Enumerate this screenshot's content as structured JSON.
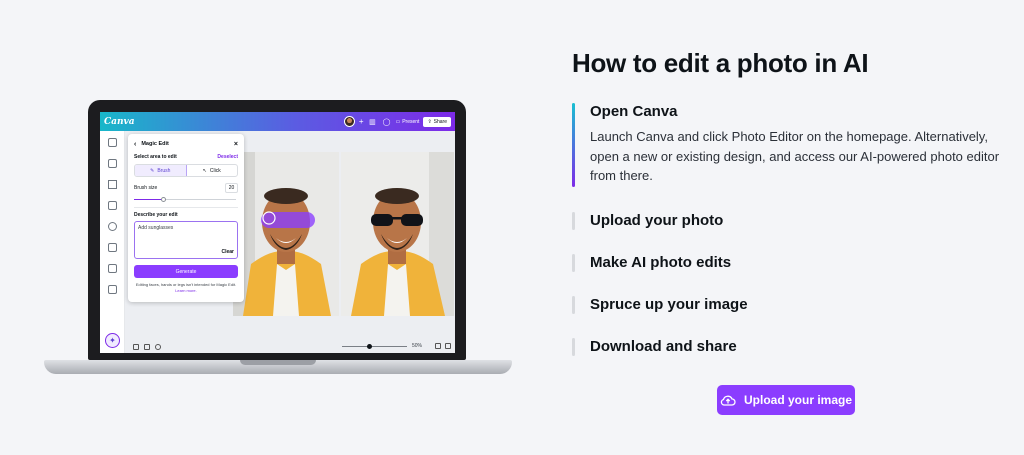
{
  "page": {
    "heading": "How to edit a photo in AI",
    "steps": [
      {
        "title": "Open Canva",
        "desc": "Launch Canva and click Photo Editor on the homepage. Alternatively, open a new or existing design, and access our AI-powered photo editor from there.",
        "active": true
      },
      {
        "title": "Upload your photo",
        "active": false
      },
      {
        "title": "Make AI photo edits",
        "active": false
      },
      {
        "title": "Spruce up your image",
        "active": false
      },
      {
        "title": "Download and share",
        "active": false
      }
    ],
    "cta_label": "Upload your image"
  },
  "editor": {
    "logo": "Canva",
    "topbar": {
      "plus": "+",
      "present_label": "Present",
      "share_label": "Share"
    },
    "panel": {
      "title": "Magic Edit",
      "select_label": "Select area to edit",
      "deselect_label": "Deselect",
      "brush_tab": "Brush",
      "click_tab": "Click",
      "brush_size_label": "Brush size",
      "brush_size_value": "20",
      "brush_size_fraction": 0.28,
      "describe_label": "Describe your edit",
      "prompt_value": "Add sunglasses",
      "clear_label": "Clear",
      "generate_label": "Generate",
      "note_text": "Editing faces, hands or legs isn't intended for Magic Edit.",
      "learn_more": "Learn more."
    },
    "zoom_label": "50%",
    "zoom_fraction": 0.42
  },
  "colors": {
    "accent_purple": "#8b3dff",
    "brand_teal": "#18b7c9",
    "text_dark": "#0e1318",
    "page_bg": "#f4f5f8"
  }
}
